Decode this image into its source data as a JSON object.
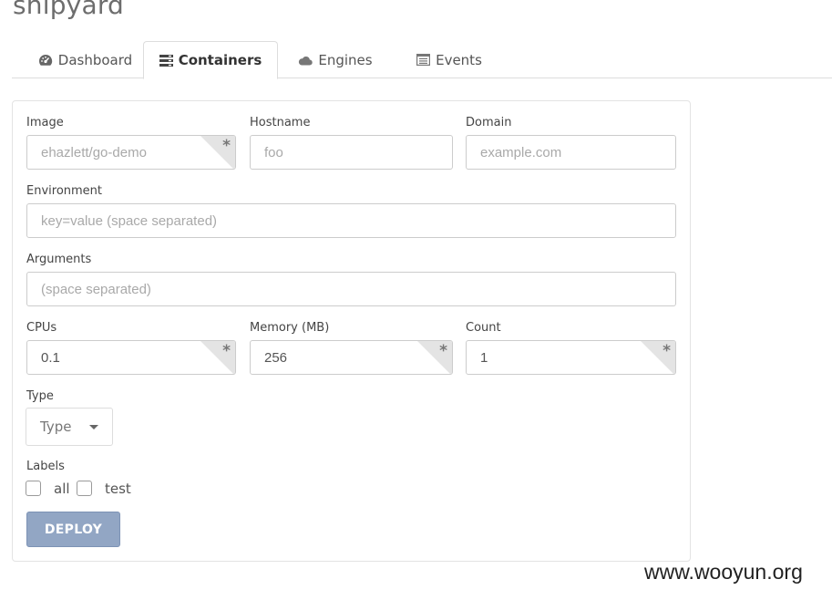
{
  "app": {
    "logo_text": "shipyard"
  },
  "tabs": [
    {
      "label": "Dashboard",
      "icon": "dashboard-icon"
    },
    {
      "label": "Containers",
      "icon": "containers-icon",
      "active": true
    },
    {
      "label": "Engines",
      "icon": "cloud-icon"
    },
    {
      "label": "Events",
      "icon": "events-icon"
    }
  ],
  "form": {
    "image": {
      "label": "Image",
      "placeholder": "ehazlett/go-demo",
      "value": "",
      "required": true
    },
    "hostname": {
      "label": "Hostname",
      "placeholder": "foo",
      "value": ""
    },
    "domain": {
      "label": "Domain",
      "placeholder": "example.com",
      "value": ""
    },
    "environment": {
      "label": "Environment",
      "placeholder": "key=value (space separated)",
      "value": ""
    },
    "arguments": {
      "label": "Arguments",
      "placeholder": "(space separated)",
      "value": ""
    },
    "cpus": {
      "label": "CPUs",
      "value": "0.1",
      "required": true
    },
    "memory": {
      "label": "Memory (MB)",
      "value": "256",
      "required": true
    },
    "count": {
      "label": "Count",
      "value": "1",
      "required": true
    },
    "type": {
      "label": "Type",
      "selected": "Type"
    },
    "labels": {
      "label": "Labels",
      "options": [
        {
          "label": "all",
          "checked": false
        },
        {
          "label": "test",
          "checked": false
        }
      ]
    },
    "required_marker": "*",
    "deploy_label": "DEPLOY"
  },
  "colors": {
    "primary_button": "#92a6c4",
    "border": "#cccccc"
  },
  "watermark": "www.wooyun.org"
}
